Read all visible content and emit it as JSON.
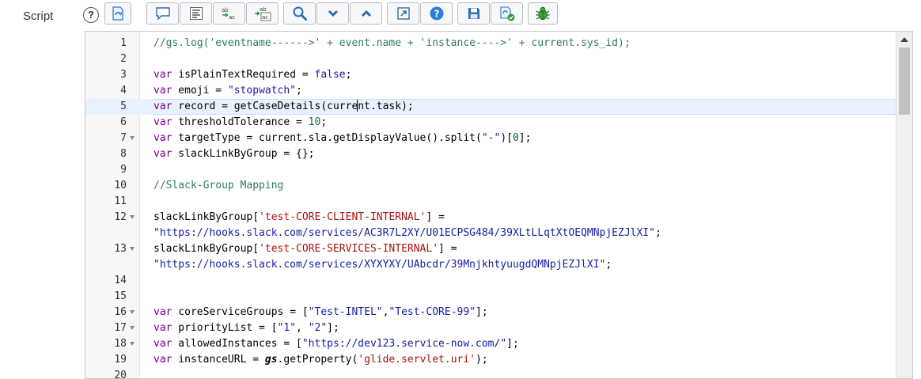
{
  "field": {
    "label": "Script",
    "help_glyph": "?"
  },
  "toolbar": {
    "buttons": [
      {
        "icon": "toggle-syntax-icon"
      },
      {
        "icon": "comment-icon"
      },
      {
        "icon": "format-code-icon"
      },
      {
        "icon": "replace-icon"
      },
      {
        "icon": "replace-all-icon"
      },
      {
        "icon": "search-icon"
      },
      {
        "icon": "chevron-down-icon"
      },
      {
        "icon": "chevron-up-icon"
      },
      {
        "icon": "fullscreen-icon"
      },
      {
        "icon": "help-icon"
      },
      {
        "icon": "save-icon"
      },
      {
        "icon": "script-debugger-icon"
      },
      {
        "icon": "debug-bug-icon"
      }
    ]
  },
  "editor": {
    "active_line": 5,
    "gutter": [
      {
        "n": "1",
        "fold": false
      },
      {
        "n": "2",
        "fold": false
      },
      {
        "n": "3",
        "fold": false
      },
      {
        "n": "4",
        "fold": false
      },
      {
        "n": "5",
        "fold": false
      },
      {
        "n": "6",
        "fold": false
      },
      {
        "n": "7",
        "fold": true
      },
      {
        "n": "8",
        "fold": false
      },
      {
        "n": "9",
        "fold": false
      },
      {
        "n": "10",
        "fold": false
      },
      {
        "n": "11",
        "fold": false
      },
      {
        "n": "12",
        "fold": true
      },
      {
        "n": "",
        "fold": false
      },
      {
        "n": "13",
        "fold": true
      },
      {
        "n": "",
        "fold": false
      },
      {
        "n": "14",
        "fold": false
      },
      {
        "n": "15",
        "fold": false
      },
      {
        "n": "16",
        "fold": true
      },
      {
        "n": "17",
        "fold": true
      },
      {
        "n": "18",
        "fold": true
      },
      {
        "n": "19",
        "fold": false
      },
      {
        "n": "20",
        "fold": false
      }
    ],
    "code": {
      "l1": "//gs.log('eventname------>' + event.name + 'instance---->' + current.sys_id);",
      "kw_var": "var",
      "l3_id": " isPlainTextRequired = ",
      "l3_val": "false",
      "l3_end": ";",
      "l4_id": " emoji = ",
      "l4_str": "\"stopwatch\"",
      "l4_end": ";",
      "l5_a": " record = getCaseDetails(curre",
      "l5_b": "nt.task);",
      "l6_id": " thresholdTolerance = ",
      "l6_num": "10",
      "l6_end": ";",
      "l7_a": " targetType = current.sla.getDisplayValue().split(",
      "l7_str": "\"-\"",
      "l7_b": ")[",
      "l7_num": "0",
      "l7_c": "];",
      "l8": " slackLinkByGroup = {};",
      "l10": "//Slack-Group Mapping",
      "l12_a": "slackLinkByGroup[",
      "l12_key": "'test-CORE-CLIENT-INTERNAL'",
      "l12_b": "] =",
      "l12_url": "\"https://hooks.slack.com/services/AC3R7L2XY/U01ECPSG484/39XLtLLqtXtOEQMNpjEZJlXI\"",
      "l12_end": ";",
      "l13_a": "slackLinkByGroup[",
      "l13_key": "'test-CORE-SERVICES-INTERNAL'",
      "l13_b": "] =",
      "l13_url": "\"https://hooks.slack.com/services/XYXYXY/UAbcdr/39MnjkhtyuugdQMNpjEZJlXI\"",
      "l13_end": ";",
      "l16_a": " coreServiceGroups = [",
      "l16_s1": "\"Test-INTEL\"",
      "l16_c": ",",
      "l16_s2": "\"Test-CORE-99\"",
      "l16_end": "];",
      "l17_a": " priorityList = [",
      "l17_s1": "\"1\"",
      "l17_c": ", ",
      "l17_s2": "\"2\"",
      "l17_end": "];",
      "l18_a": " allowedInstances = [",
      "l18_s1": "\"https://dev123.service-now.com/\"",
      "l18_end": "];",
      "l19_a": " instanceURL = ",
      "l19_gs": "gs",
      "l19_b": ".getProperty(",
      "l19_s1": "'glide.servlet.uri'",
      "l19_end": ");"
    }
  }
}
